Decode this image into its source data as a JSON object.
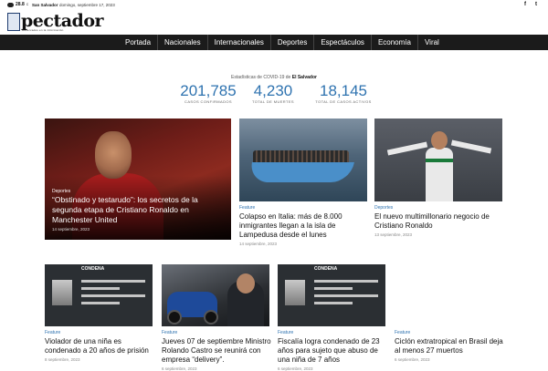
{
  "topbar": {
    "temp": "28.8",
    "temp_unit": "C",
    "city": "San Salvador",
    "date": "domingo, septiembre 17, 2023",
    "social": [
      "f",
      "t"
    ]
  },
  "logo": {
    "text": "pectador",
    "sub": "Reservados en la Información"
  },
  "nav": [
    "Portada",
    "Nacionales",
    "Internacionales",
    "Deportes",
    "Espectáculos",
    "Economía",
    "Viral"
  ],
  "covid": {
    "caption_prefix": "Estadísticas de COVID-19 de",
    "country": "El Salvador",
    "stats": [
      {
        "value": "201,785",
        "label": "CASOS CONFIRMADOS"
      },
      {
        "value": "4,230",
        "label": "TOTAL DE MUERTES"
      },
      {
        "value": "18,145",
        "label": "TOTAL DE CASOS ACTIVOS"
      }
    ]
  },
  "featured": {
    "category": "Deportes",
    "title": "“Obstinado y testarudo”: los secretos de la segunda etapa de Cristiano Ronaldo en Manchester United",
    "date": "14 septiembre, 2023"
  },
  "cards_top": [
    {
      "category": "Feature",
      "title": "Colapso en Italia: más de 8.000 inmigrantes llegan a la isla de Lampedusa desde el lunes",
      "date": "14 septiembre, 2023"
    },
    {
      "category": "Deportes",
      "title": "El nuevo multimillonario negocio de Cristiano Ronaldo",
      "date": "13 septiembre, 2023"
    }
  ],
  "cards_bottom": [
    {
      "category": "Feature",
      "title": "Violador de una niña es condenado a 20 años de prisión",
      "date": "8 septiembre, 2023",
      "image_header": "CONDENA"
    },
    {
      "category": "Feature",
      "title": "Jueves 07 de septiembre Ministro Rolando Castro se reunirá con empresa “delivery”.",
      "date": "6 septiembre, 2023"
    },
    {
      "category": "Feature",
      "title": "Fiscalía logra condenado de 23 años para sujeto que abuso de una niña de 7 años",
      "date": "6 septiembre, 2023",
      "image_header": "CONDENA"
    },
    {
      "category": "Feature",
      "title": "Ciclón extratropical en Brasil deja al menos 27 muertos",
      "date": "6 septiembre, 2023"
    }
  ],
  "colors": {
    "nav_bg": "#1b1b1b",
    "accent_blue": "#2f73b0"
  }
}
